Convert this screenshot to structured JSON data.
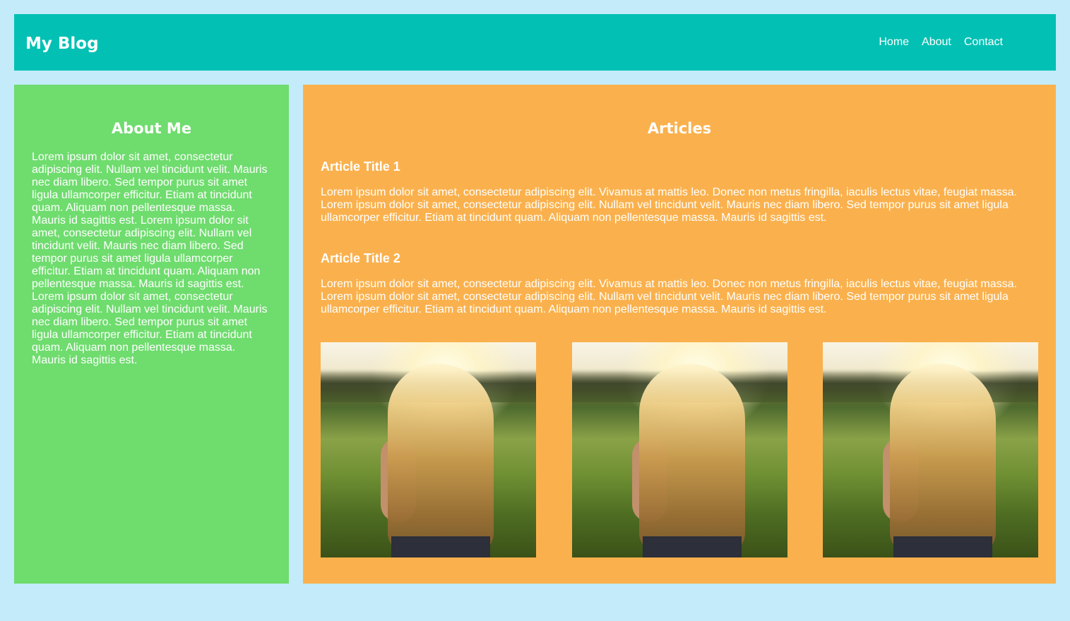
{
  "header": {
    "logo": "My Blog",
    "nav": [
      "Home",
      "About",
      "Contact"
    ]
  },
  "sidebar": {
    "title": "About Me",
    "text": "Lorem ipsum dolor sit amet, consectetur adipiscing elit. Nullam vel tincidunt velit. Mauris nec diam libero. Sed tempor purus sit amet ligula ullamcorper efficitur. Etiam at tincidunt quam. Aliquam non pellentesque massa. Mauris id sagittis est. Lorem ipsum dolor sit amet, consectetur adipiscing elit. Nullam vel tincidunt velit. Mauris nec diam libero. Sed tempor purus sit amet ligula ullamcorper efficitur. Etiam at tincidunt quam. Aliquam non pellentesque massa. Mauris id sagittis est. Lorem ipsum dolor sit amet, consectetur adipiscing elit. Nullam vel tincidunt velit. Mauris nec diam libero. Sed tempor purus sit amet ligula ullamcorper efficitur. Etiam at tincidunt quam. Aliquam non pellentesque massa. Mauris id sagittis est."
  },
  "main": {
    "title": "Articles",
    "articles": [
      {
        "title": "Article Title 1",
        "text": "Lorem ipsum dolor sit amet, consectetur adipiscing elit. Vivamus at mattis leo. Donec non metus fringilla, iaculis lectus vitae, feugiat massa. Lorem ipsum dolor sit amet, consectetur adipiscing elit. Nullam vel tincidunt velit. Mauris nec diam libero. Sed tempor purus sit amet ligula ullamcorper efficitur. Etiam at tincidunt quam. Aliquam non pellentesque massa. Mauris id sagittis est."
      },
      {
        "title": "Article Title 2",
        "text": "Lorem ipsum dolor sit amet, consectetur adipiscing elit. Vivamus at mattis leo. Donec non metus fringilla, iaculis lectus vitae, feugiat massa. Lorem ipsum dolor sit amet, consectetur adipiscing elit. Nullam vel tincidunt velit. Mauris nec diam libero. Sed tempor purus sit amet ligula ullamcorper efficitur. Etiam at tincidunt quam. Aliquam non pellentesque massa. Mauris id sagittis est."
      }
    ],
    "gallery_count": 3
  },
  "colors": {
    "page_background": "#c3ebf9",
    "header": "#02c1b4",
    "sidebar": "#6fdc6e",
    "main": "#fab14d",
    "text": "#ffffff"
  },
  "icons": {
    "gallery_image": "photo-woman-sunlit-field"
  }
}
